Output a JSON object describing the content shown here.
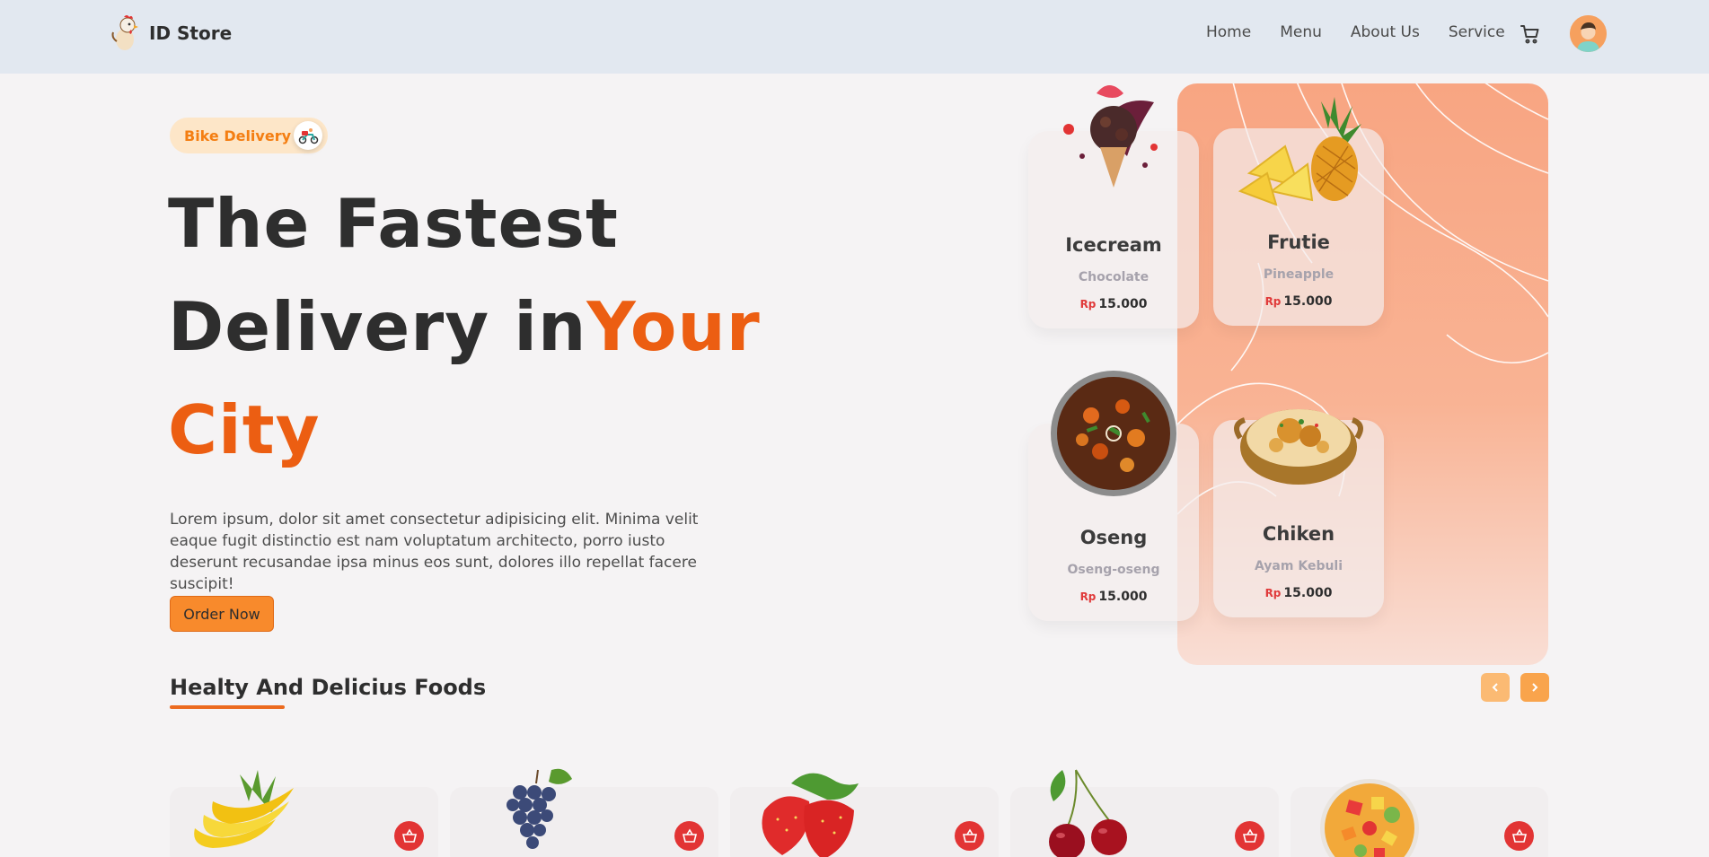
{
  "header": {
    "brand": "ID Store",
    "nav": [
      "Home",
      "Menu",
      "About Us",
      "Service"
    ]
  },
  "hero": {
    "badge": "Bike Delivery",
    "headline_line1": "The Fastest",
    "headline_line2": "Delivery in",
    "headline_accent1": "Your",
    "headline_accent2": "City",
    "description": "Lorem ipsum, dolor sit amet consectetur adipisicing elit. Minima velit eaque fugit distinctio est nam voluptatum architecto, porro iusto deserunt recusandae ipsa minus eos sunt, dolores illo repellat facere suscipit!",
    "cta": "Order Now"
  },
  "cards": [
    {
      "title": "Icecream",
      "subtitle": "Chocolate",
      "currency": "Rp",
      "price": "15.000"
    },
    {
      "title": "Frutie",
      "subtitle": "Pineapple",
      "currency": "Rp",
      "price": "15.000"
    },
    {
      "title": "Oseng",
      "subtitle": "Oseng-oseng",
      "currency": "Rp",
      "price": "15.000"
    },
    {
      "title": "Chiken",
      "subtitle": "Ayam Kebuli",
      "currency": "Rp",
      "price": "15.000"
    }
  ],
  "section": {
    "title": "Healty And Delicius Foods"
  },
  "fruits": [
    "banana",
    "grapes",
    "strawberry",
    "cherry",
    "fruit-salad"
  ],
  "colors": {
    "accent": "#ec5e12",
    "button": "#f88a2c",
    "header_bg": "#e2e8f0",
    "cart_red": "#e23434"
  }
}
